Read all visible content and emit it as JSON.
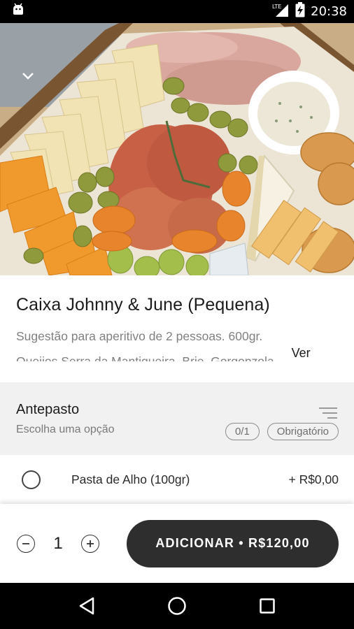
{
  "status_bar": {
    "time": "20:38",
    "network": "LTE",
    "icons": [
      "android-debug-icon",
      "lte-signal-icon",
      "battery-charging-icon"
    ]
  },
  "product": {
    "title": "Caixa Johnny & June (Pequena)",
    "description_line1": "Sugestão para aperitivo de 2 pessoas. 600gr.",
    "description_line2": "Queijos Serra da Mantiqueira, Brie, Gorgonzola",
    "more_label": "Ver mais"
  },
  "option_group": {
    "title": "Antepasto",
    "subtitle": "Escolha uma opção",
    "count_badge": "0/1",
    "required_badge": "Obrigatório",
    "icon": "filter-lines-icon"
  },
  "options": [
    {
      "label": "Pasta de Alho (100gr)",
      "price": "+ R$0,00",
      "selected": false
    }
  ],
  "cart": {
    "quantity": "1",
    "add_button_label": "ADICIONAR • R$120,00"
  },
  "colors": {
    "button_bg": "#2e2e2e",
    "group_bg": "#f1f1f1",
    "muted_text": "#808080"
  }
}
